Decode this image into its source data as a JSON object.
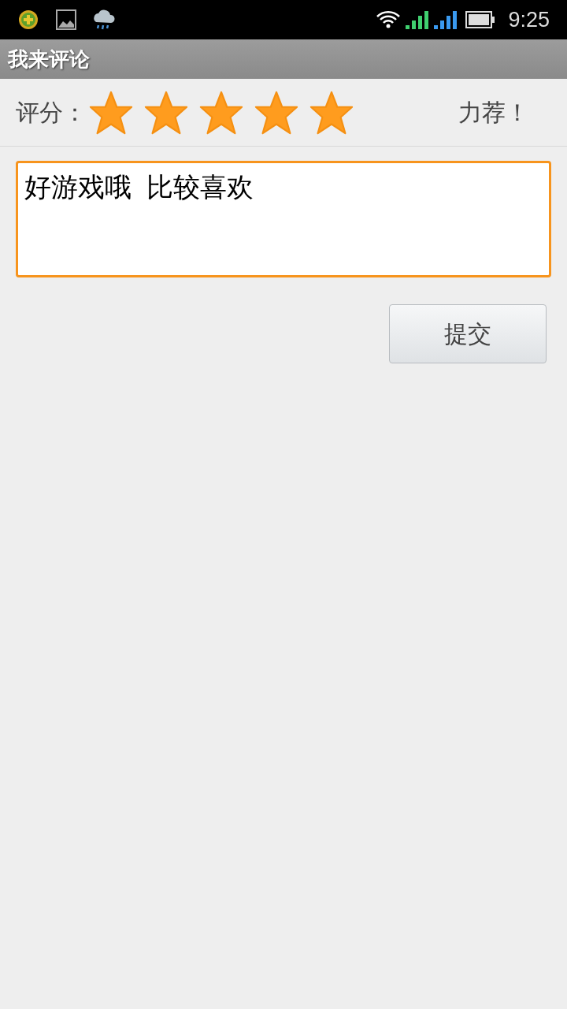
{
  "status_bar": {
    "time": "9:25"
  },
  "title_bar": {
    "title": "我来评论"
  },
  "rating": {
    "label": "评分：",
    "stars": 5,
    "verdict": "力荐！"
  },
  "comment": {
    "value": "好游戏哦  比较喜欢"
  },
  "submit_button": {
    "label": "提交"
  }
}
